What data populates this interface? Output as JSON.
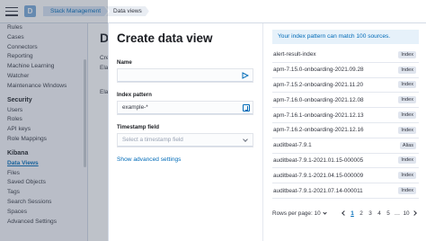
{
  "header": {
    "space_initial": "D",
    "breadcrumbs": [
      "Stack Management",
      "Data views"
    ]
  },
  "sidebar": {
    "items_top": [
      "Rules",
      "Cases",
      "Connectors",
      "Reporting",
      "Machine Learning",
      "Watcher",
      "Maintenance Windows"
    ],
    "security_label": "Security",
    "security_items": [
      "Users",
      "Roles",
      "API keys",
      "Role Mappings"
    ],
    "kibana_label": "Kibana",
    "kibana_items": [
      "Data Views",
      "Files",
      "Saved Objects",
      "Tags",
      "Search Sessions",
      "Spaces",
      "Advanced Settings"
    ]
  },
  "background": {
    "title": "D",
    "text1": "Cre",
    "text2": "Ela",
    "text3": "Ela"
  },
  "flyout": {
    "title": "Create data view",
    "name_label": "Name",
    "name_value": "",
    "index_pattern_label": "Index pattern",
    "index_pattern_value": "example-*",
    "timestamp_label": "Timestamp field",
    "timestamp_placeholder": "Select a timestamp field",
    "advanced_link": "Show advanced settings"
  },
  "preview": {
    "callout": "Your index pattern can match 100 sources.",
    "rows": [
      {
        "name": "alert-result-index",
        "type": "Index"
      },
      {
        "name": "apm-7.15.0-onboarding-2021.09.28",
        "type": "Index"
      },
      {
        "name": "apm-7.15.2-onboarding-2021.11.20",
        "type": "Index"
      },
      {
        "name": "apm-7.16.0-onboarding-2021.12.08",
        "type": "Index"
      },
      {
        "name": "apm-7.16.1-onboarding-2021.12.13",
        "type": "Index"
      },
      {
        "name": "apm-7.16.2-onboarding-2021.12.16",
        "type": "Index"
      },
      {
        "name": "auditbeat-7.9.1",
        "type": "Alias"
      },
      {
        "name": "auditbeat-7.9.1-2021.01.15-000005",
        "type": "Index"
      },
      {
        "name": "auditbeat-7.9.1-2021.04.15-000009",
        "type": "Index"
      },
      {
        "name": "auditbeat-7.9.1-2021.07.14-000011",
        "type": "Index"
      }
    ],
    "rows_per_page": "Rows per page: 10",
    "pages": [
      "1",
      "2",
      "4",
      "5",
      "...",
      "10"
    ],
    "pages_visible": [
      "1",
      "2",
      "3",
      "4",
      "5",
      "10"
    ]
  }
}
